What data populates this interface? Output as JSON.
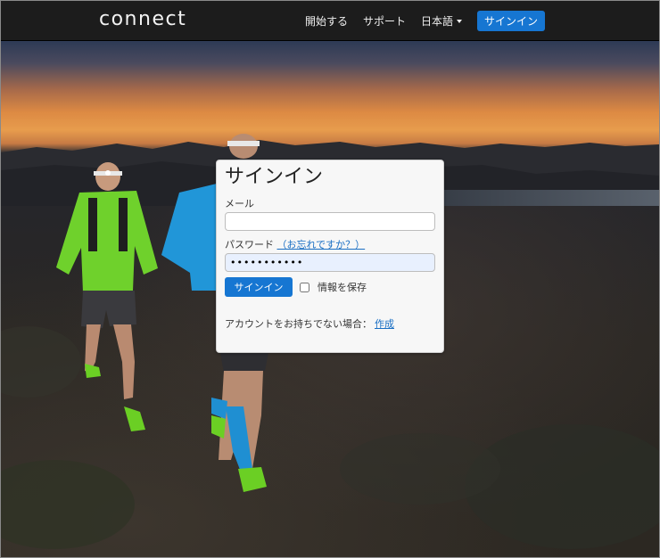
{
  "nav": {
    "logo": "connect",
    "get_started": "開始する",
    "support": "サポート",
    "language": "日本語",
    "signin": "サインイン"
  },
  "form": {
    "title": "サインイン",
    "email_label": "メール",
    "email_value": "",
    "password_label": "パスワード",
    "forgot_link": "（お忘れですか？）",
    "password_value": "•••••••••••",
    "signin_button": "サインイン",
    "remember_label": "情報を保存",
    "remember_checked": false,
    "no_account_text": "アカウントをお持ちでない場合：",
    "create_link": "作成"
  },
  "colors": {
    "accent": "#1676d2",
    "navbar": "#1c1c1c",
    "link": "#1a6fc4"
  }
}
